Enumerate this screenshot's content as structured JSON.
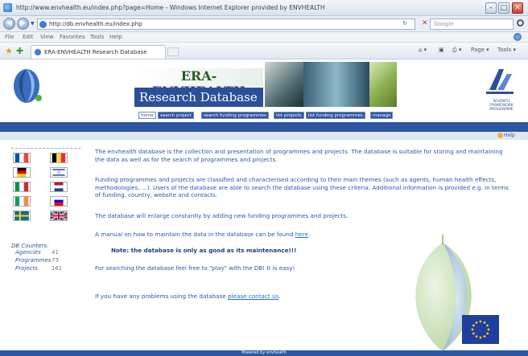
{
  "window": {
    "title": "http://www.envhealth.eu/index.php?page=Home - Windows Internet Explorer provided by ENVHEALTH",
    "controls": {
      "minimize": "–",
      "maximize": "□",
      "close": "✕"
    }
  },
  "addressbar": {
    "url": "http://db.envhealth.eu/index.php",
    "search_placeholder": "Google"
  },
  "menubar": {
    "items": [
      "File",
      "Edit",
      "View",
      "Favorites",
      "Tools",
      "Help"
    ]
  },
  "tabbar": {
    "tab_title": "ERA-ENVHEALTH Research Database",
    "tools": [
      "Page ▾",
      "Tools ▾"
    ]
  },
  "header": {
    "title_part1": "ERA-",
    "title_part2": "ENVHEALTH",
    "subtitle": "Research Database",
    "right_logo_caption": "SEVENTH FRAMEWORK PROGRAMME"
  },
  "nav": {
    "tabs": [
      {
        "label": "home",
        "active": true
      },
      {
        "label": "search project",
        "active": false
      },
      {
        "label": "search funding programmes",
        "active": false
      },
      {
        "label": "list projects",
        "active": false
      },
      {
        "label": "list funding programmes",
        "active": false
      },
      {
        "label": "manage",
        "active": false
      }
    ],
    "help_label": "Help"
  },
  "sidebar": {
    "flags": [
      {
        "country": "France",
        "colors": [
          "#0055a4",
          "#ffffff",
          "#ef4135"
        ],
        "orientation": "vertical"
      },
      {
        "country": "Belgium",
        "colors": [
          "#000000",
          "#fae042",
          "#ed2939"
        ],
        "orientation": "vertical"
      },
      {
        "country": "Germany",
        "colors": [
          "#000000",
          "#dd0000",
          "#ffce00"
        ],
        "orientation": "horizontal"
      },
      {
        "country": "Israel",
        "colors": [
          "#ffffff",
          "#0038b8",
          "#ffffff"
        ],
        "orientation": "horizontal"
      },
      {
        "country": "Italy",
        "colors": [
          "#009246",
          "#ffffff",
          "#ce2b37"
        ],
        "orientation": "vertical"
      },
      {
        "country": "Netherlands",
        "colors": [
          "#ae1c28",
          "#ffffff",
          "#21468b"
        ],
        "orientation": "horizontal"
      },
      {
        "country": "Ireland",
        "colors": [
          "#169b62",
          "#ffffff",
          "#ff883e"
        ],
        "orientation": "vertical"
      },
      {
        "country": "Slovenia",
        "colors": [
          "#ffffff",
          "#0000ff",
          "#ff0000"
        ],
        "orientation": "horizontal"
      },
      {
        "country": "Sweden",
        "colors": [
          "#006aa7",
          "#fecc00"
        ],
        "orientation": "cross"
      },
      {
        "country": "United Kingdom",
        "colors": [
          "#012169",
          "#ffffff",
          "#c8102e"
        ],
        "orientation": "union"
      }
    ],
    "counters_title": "DB Counters:",
    "counters": [
      {
        "label": "Agencies",
        "value": "41"
      },
      {
        "label": "Programmes",
        "value": "75"
      },
      {
        "label": "Projects",
        "value": "161"
      }
    ]
  },
  "content": {
    "p1": "The envhealth database is the collection and presentation of programmes and projects. The database is suitable for storing and maintaining the data as well as for the search of programmes and projects.",
    "p2": "Funding programmes and projects are classified and characterised according to their main themes (such as agents, human health effects, methodologies, ...). Users of the database are able to search the database using these criteria. Additional information is provided e.g. in terms of funding, country, website and contacts.",
    "p3": "The database will enlarge constantly by adding new funding programmes and projects.",
    "p4_prefix": "A manual on how to maintain the data in the database can be found ",
    "p4_link": "here",
    "p4_suffix": ".",
    "note": "Note: the database is only as good as its maintenance!!!",
    "p5": "For searching the database feel free to \"play\" with the DB! It is easy!",
    "p6_prefix": "If you have any problems using the database ",
    "p6_link": "please contact us",
    "p6_suffix": "."
  },
  "footer": {
    "text": "Powered by envhealth"
  }
}
